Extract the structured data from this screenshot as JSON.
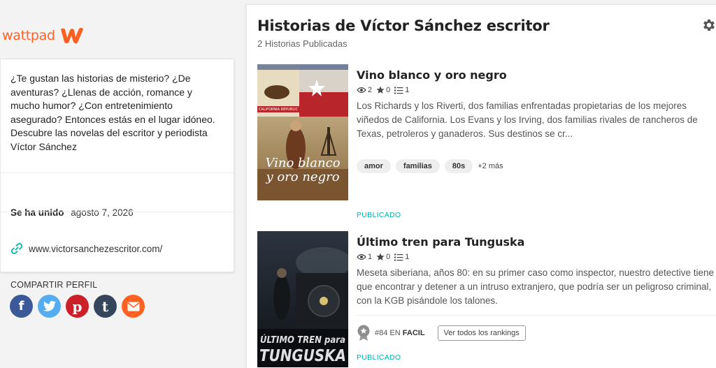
{
  "brand": {
    "name": "wattpad",
    "color": "#ff6122"
  },
  "about": {
    "description": "¿Te gustan las historias de misterio? ¿De aventuras? ¿Llenas de acción, romance y mucho humor? ¿Con entretenimiento asegurado? Entonces estás en el lugar idóneo. Descubre las novelas del escritor y periodista Víctor Sánchez",
    "joined_label": "Se ha unido",
    "joined_date": "agosto 7, 2026",
    "website": "www.victorsanchezescritor.com/",
    "share_title": "COMPARTIR PERFIL",
    "social": [
      {
        "icon": "facebook-icon",
        "glyph": "f"
      },
      {
        "icon": "twitter-icon",
        "glyph": "t"
      },
      {
        "icon": "pinterest-icon",
        "glyph": "p"
      },
      {
        "icon": "tumblr-icon",
        "glyph": "t"
      },
      {
        "icon": "email-icon",
        "glyph": "✉"
      }
    ]
  },
  "main": {
    "title": "Historias de Víctor Sánchez escritor",
    "subtitle": "2 Historias Publicadas",
    "stories": [
      {
        "title": "Vino blanco y oro negro",
        "reads": "2",
        "votes": "0",
        "parts": "1",
        "description": "Los Richards y los Riverti, dos familias enfrentadas propietarias de los mejores viñedos de California. Los Evans y los Irving, dos familias rivales de rancheros de Texas, petroleros y ganaderos. Sus destinos se cr...",
        "tags": [
          "amor",
          "familias",
          "80s"
        ],
        "more_tags": "+2 más",
        "status": "PUBLICADO",
        "cover_line1": "Vino blanco",
        "cover_line2": "y oro negro",
        "cover_flag": "CALIFORNIA REPUBLIC"
      },
      {
        "title": "Último tren para Tunguska",
        "reads": "1",
        "votes": "0",
        "parts": "1",
        "description": "Meseta siberiana, años 80: en su primer caso como inspector, nuestro detective tiene que encontrar y detener a un intruso extranjero, que podría ser un peligroso criminal, con la KGB pisándole los talones.",
        "rank_number": "#84",
        "rank_in": "EN",
        "rank_category": "FACIL",
        "rank_button": "Ver todos los rankings",
        "status": "PUBLICADO",
        "cover_line1": "ÚLTIMO TREN para",
        "cover_line2": "TUNGUSKA"
      }
    ]
  }
}
